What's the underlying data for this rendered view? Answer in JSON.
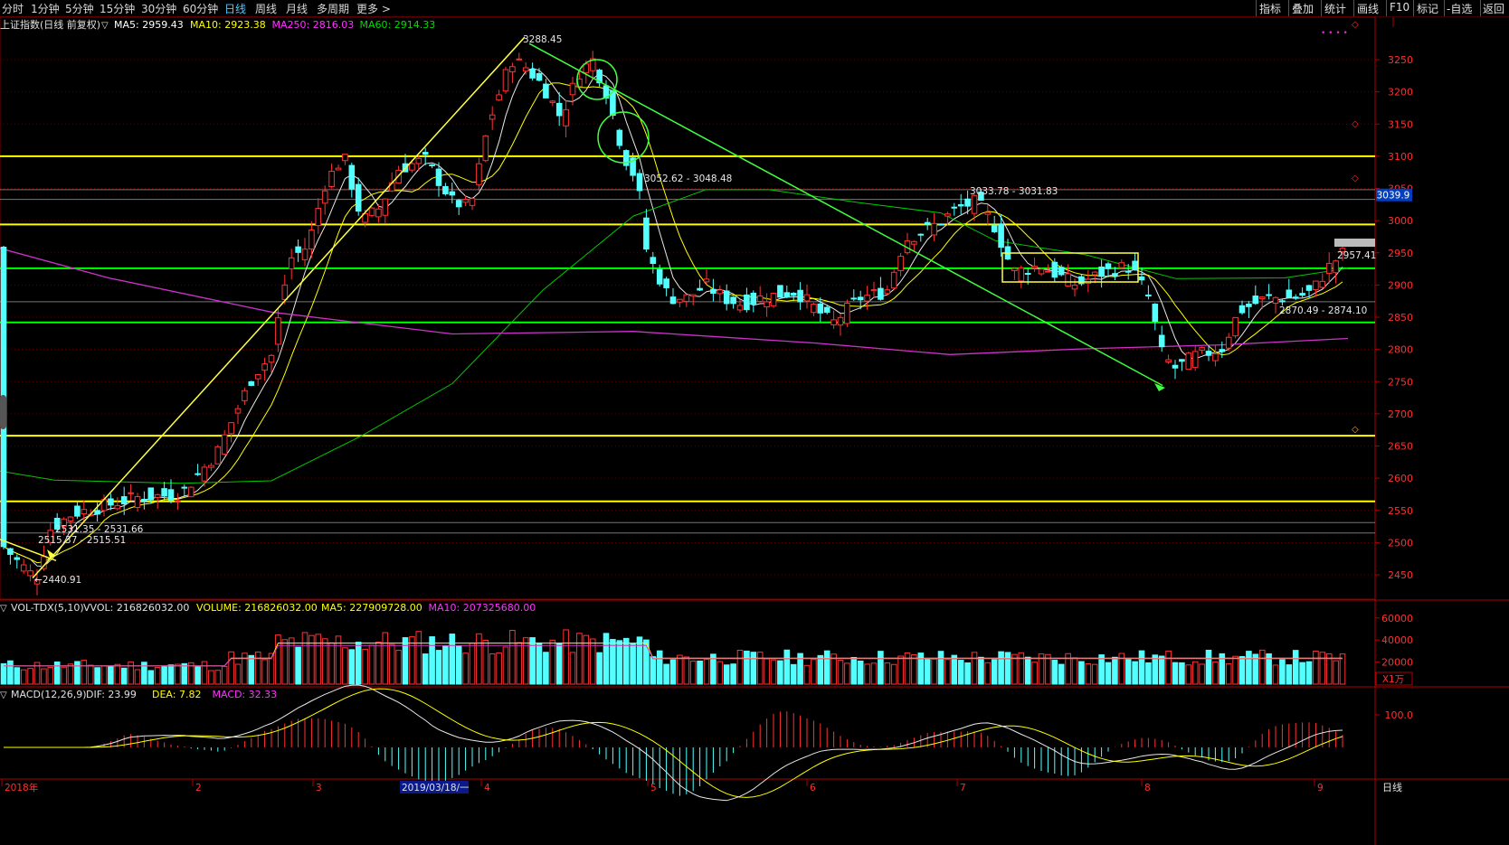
{
  "toolbar": {
    "tabs": [
      "分时",
      "1分钟",
      "5分钟",
      "15分钟",
      "30分钟",
      "60分钟",
      "日线",
      "周线",
      "月线",
      "多周期",
      "更多 >"
    ],
    "active_tab": "日线",
    "right_buttons": [
      "指标",
      "叠加",
      "统计",
      "画线",
      "F10",
      "标记",
      "-自选",
      "返回"
    ]
  },
  "chart_data": [
    {
      "type": "candlestick",
      "title": "上证指数(日线 前复权)",
      "indicators": [
        {
          "name": "MA5",
          "value": "2959.43",
          "color": "#ffffff"
        },
        {
          "name": "MA10",
          "value": "2923.38",
          "color": "#ffff00"
        },
        {
          "name": "MA250",
          "value": "2816.03",
          "color": "#ff33ff"
        },
        {
          "name": "MA60",
          "value": "2914.33",
          "color": "#00dd00"
        }
      ],
      "y_ticks": [
        3250,
        3200,
        3150,
        3100,
        3050,
        3000,
        2950,
        2900,
        2850,
        2800,
        2750,
        2700,
        2650,
        2600,
        2550,
        2500,
        2450
      ],
      "ylim": [
        2423,
        3300
      ],
      "current_price": "3039.9",
      "last_close_label": "2957.41",
      "x_labels": [
        "2018年",
        "2",
        "3",
        "2019/03/18/一",
        "4",
        "5",
        "6",
        "7",
        "8",
        "9"
      ],
      "annotations": [
        {
          "text": "3288.45",
          "x": "2019-04-08",
          "y": 3288.45
        },
        {
          "text": "3052.62 - 3048.48",
          "x": "2019-05-06",
          "y": 3050
        },
        {
          "text": "3033.78 - 3031.83",
          "x": "2019-07-02",
          "y": 3032
        },
        {
          "text": "2870.49 - 2874.10",
          "x": "2019-09-02",
          "y": 2872
        },
        {
          "text": "2531.35 - 2531.66",
          "x": "2019-01-07",
          "y": 2531
        },
        {
          "text": "2515.37 - 2515.51",
          "x": "2019-01-04",
          "y": 2515
        },
        {
          "text": "2440.91",
          "x": "2019-01-04",
          "y": 2440.91
        },
        {
          "text": "2957.41",
          "x": "2019-09-10",
          "y": 2957.41
        }
      ],
      "horizontal_lines": [
        {
          "y": 3100,
          "color": "#ffff00"
        },
        {
          "y": 2994,
          "color": "#ffff00"
        },
        {
          "y": 2926,
          "color": "#00ff00"
        },
        {
          "y": 2842,
          "color": "#00ff00"
        },
        {
          "y": 2666,
          "color": "#ffff00"
        },
        {
          "y": 2564,
          "color": "#ffff00"
        },
        {
          "y": 3048,
          "color": "#aaaaaa"
        },
        {
          "y": 3033,
          "color": "#aaaaaa"
        },
        {
          "y": 2874,
          "color": "#aaaaaa"
        },
        {
          "y": 2531,
          "color": "#aaaaaa"
        },
        {
          "y": 2515,
          "color": "#aaaaaa"
        }
      ],
      "ma250": [
        [
          0,
          2957
        ],
        [
          120,
          2911
        ],
        [
          300,
          2858
        ],
        [
          500,
          2824
        ],
        [
          700,
          2828
        ],
        [
          900,
          2810
        ],
        [
          1050,
          2792
        ],
        [
          1200,
          2801
        ],
        [
          1350,
          2807
        ],
        [
          1490,
          2817
        ]
      ],
      "ma60": [
        [
          0,
          2611
        ],
        [
          60,
          2597
        ],
        [
          200,
          2592
        ],
        [
          300,
          2596
        ],
        [
          400,
          2666
        ],
        [
          500,
          2747
        ],
        [
          600,
          2892
        ],
        [
          700,
          3007
        ],
        [
          780,
          3048
        ],
        [
          850,
          3048
        ],
        [
          950,
          3028
        ],
        [
          1040,
          3012
        ],
        [
          1100,
          2969
        ],
        [
          1200,
          2947
        ],
        [
          1300,
          2910
        ],
        [
          1420,
          2911
        ],
        [
          1490,
          2926
        ]
      ]
    },
    {
      "type": "bar",
      "title": "VOL-TDX(5,10)",
      "indicators": [
        {
          "name": "VVOL",
          "value": "216826032.00",
          "color": "#e0e0e0"
        },
        {
          "name": "VOLUME",
          "value": "216826032.00",
          "color": "#ffff00"
        },
        {
          "name": "MA5",
          "value": "227909728.00",
          "color": "#ffff00"
        },
        {
          "name": "MA10",
          "value": "207325680.00",
          "color": "#ff33ff"
        }
      ],
      "y_ticks": [
        60000,
        40000,
        20000
      ],
      "unit": "X1万"
    },
    {
      "type": "line",
      "title": "MACD(12,26,9)",
      "indicators": [
        {
          "name": "DIF",
          "value": "23.99",
          "color": "#e0e0e0"
        },
        {
          "name": "DEA",
          "value": "7.82",
          "color": "#ffff00"
        },
        {
          "name": "MACD",
          "value": "32.33",
          "color": "#ff33ff"
        }
      ],
      "y_ticks": [
        100.0
      ]
    }
  ],
  "status": {
    "period": "日线"
  }
}
